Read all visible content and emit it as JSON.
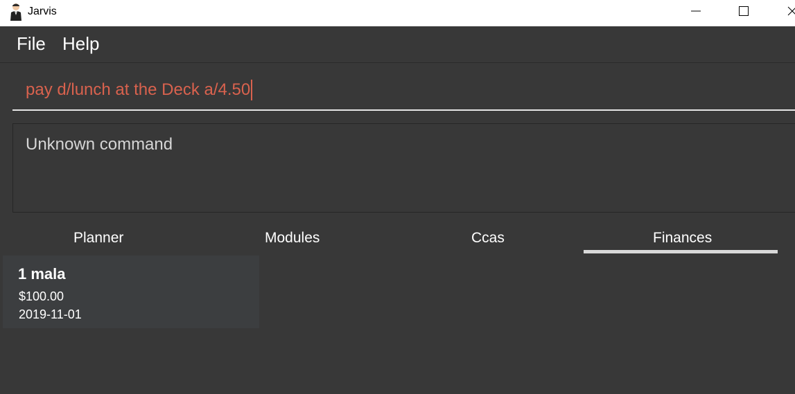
{
  "window": {
    "title": "Jarvis",
    "icon": "butler-icon"
  },
  "menu": {
    "file_label": "File",
    "help_label": "Help"
  },
  "command": {
    "value": "pay d/lunch at the Deck a/4.50",
    "text_color": "#d9624e"
  },
  "result": {
    "message": "Unknown command"
  },
  "tabs": [
    {
      "label": "Planner"
    },
    {
      "label": "Modules"
    },
    {
      "label": "Ccas"
    },
    {
      "label": "Finances",
      "selected": true
    }
  ],
  "finance_items": [
    {
      "title": "1 mala",
      "amount": "$100.00",
      "date": "2019-11-01"
    }
  ],
  "colors": {
    "background": "#383838",
    "card": "#3c3e40",
    "tab_indicator": "#d9d9d9"
  }
}
